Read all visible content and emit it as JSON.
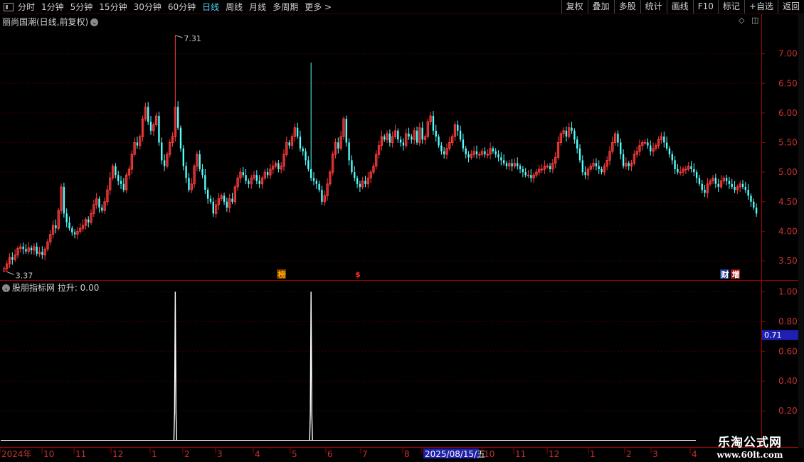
{
  "toolbar": {
    "periods": [
      "分时",
      "1分钟",
      "5分钟",
      "15分钟",
      "30分钟",
      "60分钟",
      "日线",
      "周线",
      "月线",
      "多周期",
      "更多 >"
    ],
    "active_period": "日线",
    "buttons": [
      "复权",
      "叠加",
      "多股",
      "统计",
      "画线",
      "F10",
      "标记",
      "+自选",
      "返回"
    ]
  },
  "main_panel": {
    "title": "丽尚国潮(日线,前复权)",
    "max_label": "7.31",
    "min_label": "3.37",
    "price_axis": [
      "7.00",
      "6.50",
      "6.00",
      "5.50",
      "5.00",
      "4.50",
      "4.00",
      "3.50"
    ],
    "event_markers": [
      {
        "text": "榜",
        "color": "#ffb000",
        "bg": "#7a3a00"
      },
      {
        "text": "$",
        "color": "#ff3030",
        "bg": ""
      },
      {
        "text": "财",
        "color": "#ffffff",
        "bg": "#1c3c8c"
      },
      {
        "text": "增",
        "color": "#ffffff",
        "bg": "#a01818"
      }
    ]
  },
  "indicator_panel": {
    "title": "股朋指标网  拉升: 0.00",
    "axis": [
      "1.00",
      "0.80",
      "0.60",
      "0.40",
      "0.20"
    ],
    "current_value": "0.71"
  },
  "date_axis": {
    "labels": [
      "2024年",
      "10",
      "11",
      "12",
      "1",
      "2",
      "3",
      "4",
      "5",
      "6",
      "7",
      "8",
      "2025/08/15/五",
      "10",
      "11",
      "12",
      "1",
      "2",
      "3",
      "4"
    ]
  },
  "watermark": {
    "line1": "乐淘公式网",
    "line2": "www.60lt.com"
  },
  "chart_data": {
    "type": "candlestick",
    "price_range": [
      3.2,
      7.5
    ],
    "indicator": {
      "name": "拉升",
      "range": [
        0,
        1.05
      ],
      "spikes": [
        {
          "at_candle": 63,
          "value": 1.0
        },
        {
          "at_candle": 113,
          "value": 1.0
        }
      ]
    },
    "closes": [
      3.37,
      3.45,
      3.56,
      3.52,
      3.6,
      3.71,
      3.74,
      3.7,
      3.66,
      3.72,
      3.68,
      3.74,
      3.62,
      3.65,
      3.6,
      3.7,
      3.82,
      3.95,
      4.1,
      4.05,
      4.35,
      4.75,
      4.3,
      4.15,
      4.05,
      3.98,
      3.95,
      4.0,
      4.05,
      4.1,
      4.2,
      4.15,
      4.3,
      4.45,
      4.55,
      4.4,
      4.35,
      4.5,
      4.7,
      4.9,
      5.1,
      4.95,
      4.85,
      4.8,
      4.7,
      4.95,
      5.05,
      5.3,
      5.5,
      5.45,
      5.6,
      5.9,
      6.1,
      5.85,
      5.7,
      5.8,
      5.95,
      5.5,
      5.2,
      5.1,
      5.3,
      5.5,
      5.6,
      6.1,
      5.75,
      5.4,
      5.1,
      4.9,
      4.7,
      4.8,
      5.1,
      5.3,
      5.05,
      4.95,
      4.7,
      4.55,
      4.5,
      4.3,
      4.45,
      4.55,
      4.6,
      4.5,
      4.4,
      4.55,
      4.5,
      4.75,
      4.9,
      5.0,
      4.95,
      4.85,
      4.8,
      4.9,
      4.95,
      4.85,
      4.8,
      4.9,
      5.0,
      4.95,
      5.05,
      5.1,
      5.15,
      5.05,
      5.1,
      5.3,
      5.5,
      5.45,
      5.6,
      5.75,
      5.6,
      5.4,
      5.35,
      5.2,
      5.05,
      4.9,
      4.85,
      4.8,
      4.7,
      4.5,
      4.6,
      4.8,
      5.0,
      5.3,
      5.5,
      5.4,
      5.6,
      5.9,
      5.5,
      5.2,
      5.0,
      4.9,
      4.8,
      4.75,
      4.85,
      4.8,
      4.9,
      5.0,
      5.1,
      5.3,
      5.45,
      5.6,
      5.55,
      5.65,
      5.5,
      5.6,
      5.7,
      5.55,
      5.5,
      5.45,
      5.65,
      5.6,
      5.55,
      5.7,
      5.5,
      5.75,
      5.55,
      5.6,
      5.85,
      5.95,
      5.7,
      5.6,
      5.45,
      5.35,
      5.3,
      5.4,
      5.5,
      5.6,
      5.8,
      5.7,
      5.55,
      5.4,
      5.3,
      5.25,
      5.3,
      5.35,
      5.3,
      5.3,
      5.35,
      5.3,
      5.3,
      5.4,
      5.35,
      5.3,
      5.25,
      5.2,
      5.15,
      5.1,
      5.15,
      5.1,
      5.15,
      5.1,
      5.05,
      5.0,
      4.95,
      4.95,
      4.9,
      4.95,
      5.0,
      5.05,
      5.05,
      5.1,
      5.1,
      5.05,
      5.15,
      5.25,
      5.5,
      5.65,
      5.7,
      5.6,
      5.75,
      5.7,
      5.55,
      5.4,
      5.2,
      5.0,
      4.95,
      5.05,
      5.1,
      5.15,
      5.1,
      5.05,
      5.0,
      5.1,
      5.2,
      5.35,
      5.5,
      5.65,
      5.5,
      5.3,
      5.1,
      5.15,
      5.1,
      5.15,
      5.3,
      5.35,
      5.45,
      5.5,
      5.5,
      5.45,
      5.35,
      5.4,
      5.45,
      5.55,
      5.6,
      5.5,
      5.4,
      5.3,
      5.2,
      5.05,
      5.0,
      5.0,
      5.05,
      5.05,
      5.1,
      5.05,
      5.0,
      4.9,
      4.8,
      4.7,
      4.65,
      4.8,
      4.85,
      4.9,
      4.8,
      4.75,
      4.85,
      4.9,
      4.85,
      4.8,
      4.75,
      4.7,
      4.75,
      4.8,
      4.75,
      4.7,
      4.6,
      4.5,
      4.4,
      4.3
    ]
  }
}
